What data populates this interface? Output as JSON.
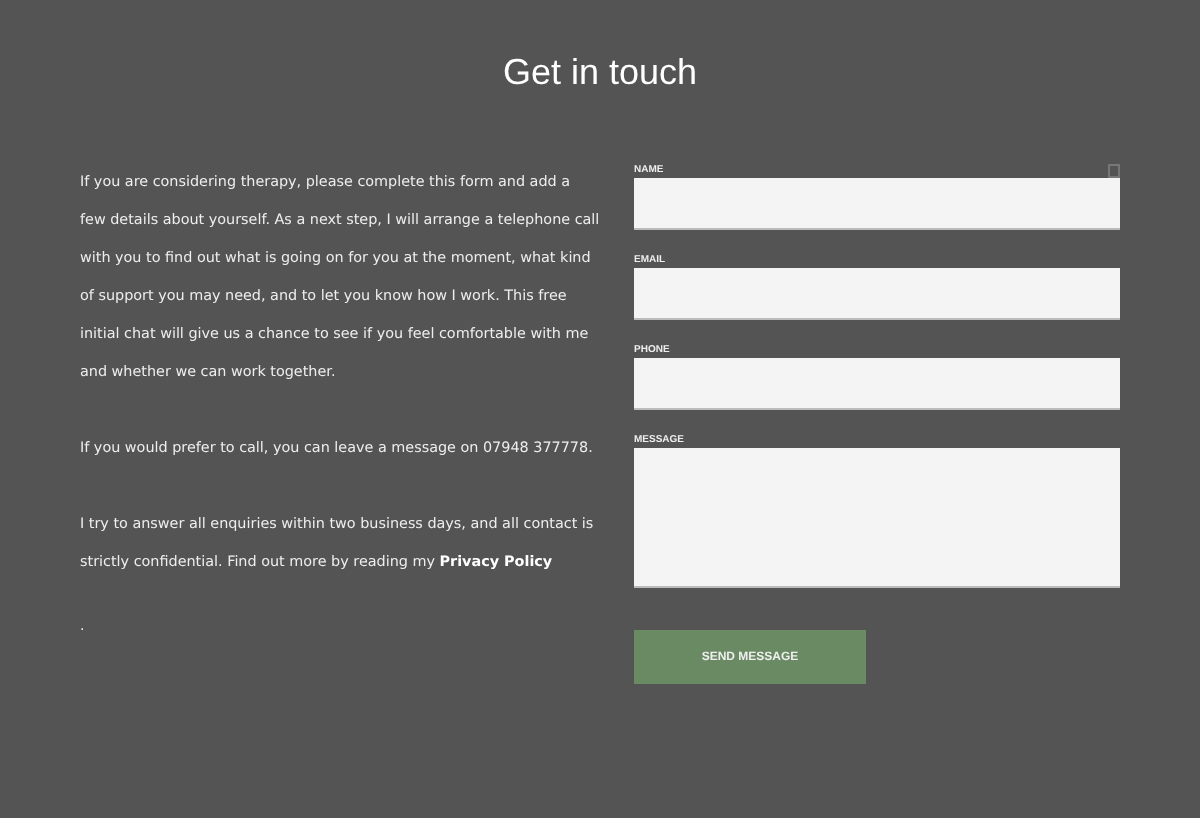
{
  "title": "Get in touch",
  "paragraphs": [
    "If you are considering therapy, please complete this form and add a few details about yourself. As a next step, I will arrange a telephone call with you to find out what is going on for you at the moment, what kind of support you may need, and to let you know how I work. This free initial chat will give us a chance to see if you feel comfortable with me and whether we can work together.",
    "If you would prefer to call, you can leave a message on 07948 377778."
  ],
  "privacy": {
    "text": "I try to answer all enquiries within two business days, and all contact is strictly confidential. Find out more by reading my",
    "link": "Privacy Policy"
  },
  "trailing": ".",
  "fields": [
    {
      "label": "NAME",
      "kind": "input",
      "icon": true
    },
    {
      "label": "EMAIL",
      "kind": "input",
      "icon": false
    },
    {
      "label": "PHONE",
      "kind": "input",
      "icon": false
    },
    {
      "label": "MESSAGE",
      "kind": "textarea",
      "icon": false
    }
  ],
  "button": "SEND MESSAGE"
}
